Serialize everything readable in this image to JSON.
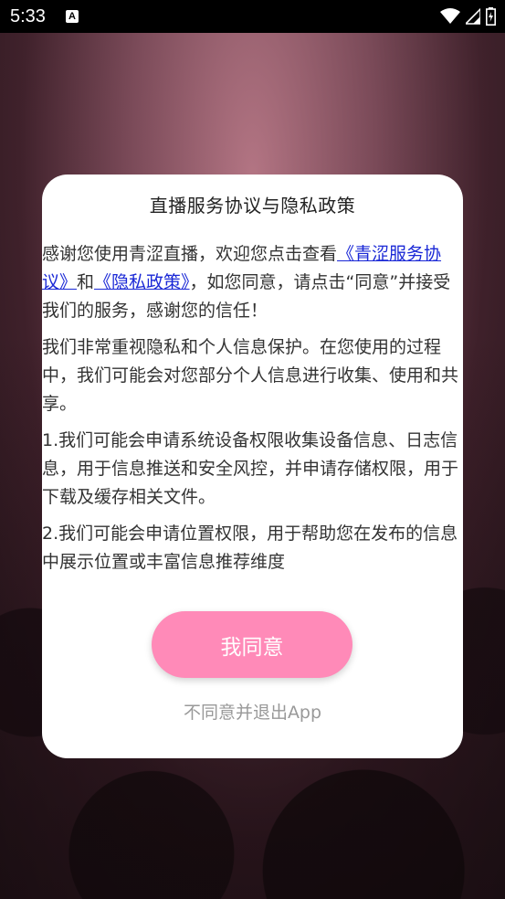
{
  "status_bar": {
    "time": "5:33",
    "notification_badge": "A",
    "icons": [
      "wifi-icon",
      "signal-icon",
      "battery-icon"
    ]
  },
  "dialog": {
    "title": "直播服务协议与隐私政策",
    "intro": {
      "part1": "感谢您使用青涩直播，欢迎您点击查看",
      "link_service": "《青涩服务协议》",
      "part2": "和",
      "link_privacy": "《隐私政策》",
      "part3": "，如您同意，请点击“同意”并接受我们的服务，感谢您的信任！"
    },
    "paragraphs": [
      "我们非常重视隐私和个人信息保护。在您使用的过程中，我们可能会对您部分个人信息进行收集、使用和共享。",
      "1.我们可能会申请系统设备权限收集设备信息、日志信息，用于信息推送和安全风控，并申请存储权限，用于下载及缓存相关文件。",
      "2.我们可能会申请位置权限，用于帮助您在发布的信息中展示位置或丰富信息推荐维度"
    ],
    "agree_label": "我同意",
    "disagree_label": "不同意并退出App"
  },
  "colors": {
    "accent": "#ff8ab8",
    "link": "#1a28d6"
  }
}
